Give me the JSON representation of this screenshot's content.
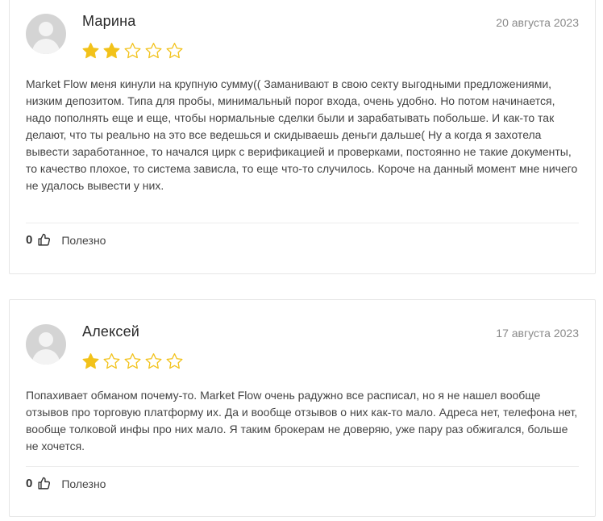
{
  "colors": {
    "star_filled": "#F2C21A",
    "star_empty_stroke": "#F2C21A",
    "border": "#E6E6E6",
    "date_text": "#8A8A8A"
  },
  "reviews": [
    {
      "author": "Марина",
      "date": "20 августа 2023",
      "rating": 2,
      "max_rating": 5,
      "text": "Market Flow меня кинули на крупную сумму(( Заманивают в свою секту выгодными предложениями, низким депозитом. Типа для пробы, минимальный порог входа, очень удобно. Но потом начинается, надо пополнять еще и еще, чтобы нормальные сделки были и зарабатывать побольше. И как-то так делают, что ты реально на это все ведешься и скидываешь деньги дальше( Ну а когда я захотела вывести заработанное, то начался цирк с верификацией и проверками, постоянно не такие документы, то качество плохое, то система зависла, то еще что-то случилось. Короче на данный момент мне ничего не удалось вывести у них.",
      "likes": "0",
      "helpful_label": "Полезно",
      "like_icon": "thumbs-up-icon",
      "avatar_icon": "user-avatar-icon"
    },
    {
      "author": "Алексей",
      "date": "17 августа 2023",
      "rating": 1,
      "max_rating": 5,
      "text": "Попахивает обманом почему-то. Market Flow очень радужно все расписал, но я не нашел вообще отзывов про торговую платформу их. Да и вообще отзывов о них как-то мало. Адреса нет, телефона нет, вообще толковой инфы про них мало. Я таким брокерам не доверяю, уже пару раз обжигался, больше не хочется.",
      "likes": "0",
      "helpful_label": "Полезно",
      "like_icon": "thumbs-up-icon",
      "avatar_icon": "user-avatar-icon"
    }
  ]
}
